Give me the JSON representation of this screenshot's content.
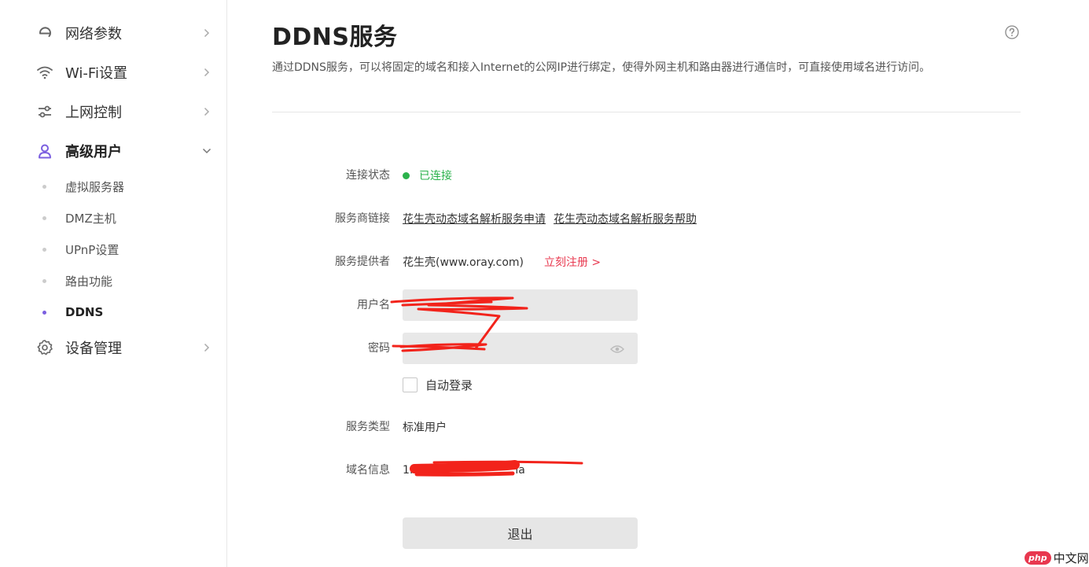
{
  "sidebar": {
    "items": [
      {
        "label": "网络参数",
        "icon": "ie-icon"
      },
      {
        "label": "Wi-Fi设置",
        "icon": "wifi-icon"
      },
      {
        "label": "上网控制",
        "icon": "sliders-icon"
      },
      {
        "label": "高级用户",
        "icon": "user-icon"
      },
      {
        "label": "设备管理",
        "icon": "gear-icon"
      }
    ],
    "subitems": [
      "虚拟服务器",
      "DMZ主机",
      "UPnP设置",
      "路由功能",
      "DDNS"
    ]
  },
  "main": {
    "title": "DDNS服务",
    "description": "通过DDNS服务，可以将固定的域名和接入Internet的公网IP进行绑定，使得外网主机和路由器进行通信时，可直接使用域名进行访问。",
    "status": {
      "label": "连接状态",
      "value": "已连接"
    },
    "provider_links": {
      "label": "服务商链接",
      "link1": "花生壳动态域名解析服务申请",
      "link2": "花生壳动态域名解析服务帮助"
    },
    "provider": {
      "label": "服务提供者",
      "value": "花生壳(www.oray.com)",
      "register": "立刻注册 >"
    },
    "username": {
      "label": "用户名",
      "value": ""
    },
    "password": {
      "label": "密码",
      "value": ""
    },
    "auto_login": {
      "label": "自动登录",
      "checked": false
    },
    "service_type": {
      "label": "服务类型",
      "value": "标准用户"
    },
    "domain_info": {
      "label": "域名信息",
      "value_prefix": "1.",
      "value_suffix": "la"
    },
    "logout": "退出"
  },
  "colors": {
    "accent": "#7b5fe0",
    "connected": "#2bb24c",
    "register": "#e8384f",
    "redaction": "#f2231b"
  },
  "watermark": {
    "badge": "php",
    "text": "中文网"
  }
}
